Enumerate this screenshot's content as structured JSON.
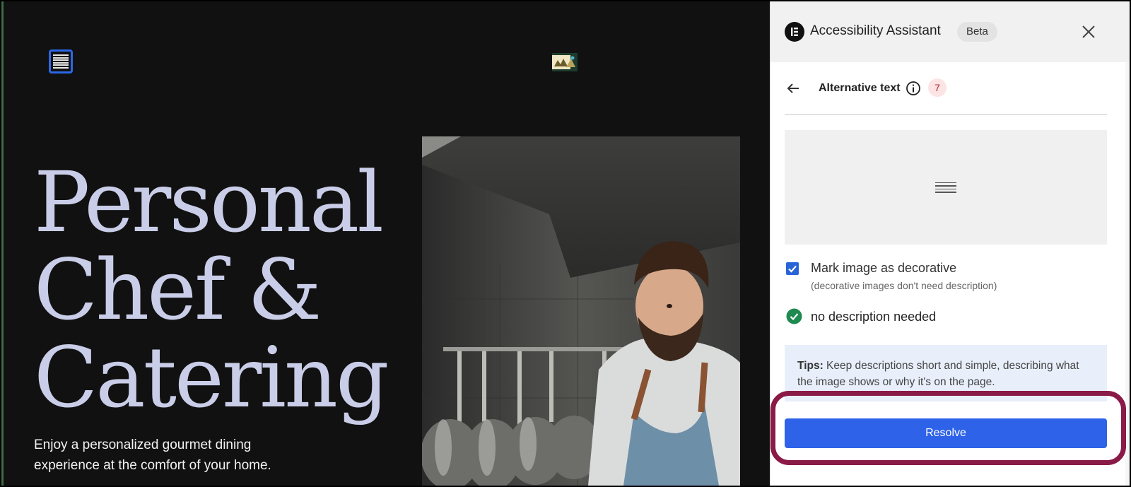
{
  "site": {
    "hero_title_lines": [
      "Personal",
      "Chef &",
      "Catering"
    ],
    "hero_subtitle_lines": [
      "Enjoy a personalized gourmet dining",
      "experience at the comfort of your home."
    ],
    "icons": {
      "menu": "hamburger-menu-icon",
      "logo": "site-logo-icon"
    },
    "photo": "chef-cooking-photo"
  },
  "panel": {
    "title": "Accessibility Assistant",
    "badge": "Beta",
    "icons": {
      "app": "elementor-logo-icon",
      "close": "close-icon",
      "back": "arrow-left-icon",
      "info": "info-icon",
      "status": "check-circle-icon"
    },
    "subheader": {
      "title": "Alternative text",
      "count": "7"
    },
    "preview": {
      "icon": "image-placeholder-icon"
    },
    "decorative": {
      "label": "Mark image as decorative",
      "hint": "(decorative images don't need description)",
      "checked": true
    },
    "status": {
      "text": "no description needed"
    },
    "tips": {
      "label": "Tips:",
      "text": " Keep descriptions short and simple, describing what the image shows or why it's on the page."
    },
    "resolve_label": "Resolve"
  },
  "colors": {
    "site_bg": "#111111",
    "hero_text": "#c9cde8",
    "accent_blue": "#2e62e8",
    "highlight": "#8a1a47",
    "success_green": "#1e8a4f",
    "count_badge_text": "#b8232a"
  }
}
